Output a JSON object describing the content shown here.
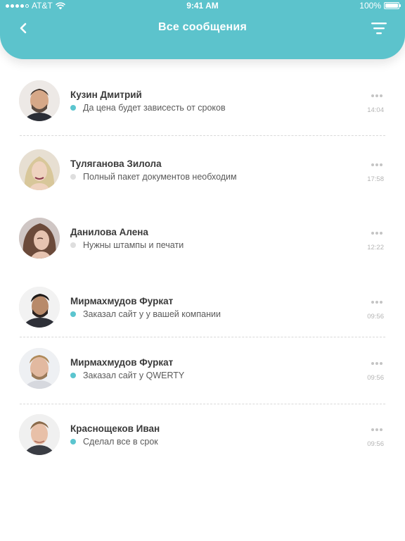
{
  "status_bar": {
    "carrier": "AT&T",
    "time": "9:41 AM",
    "battery": "100%",
    "battery_level": 1.0
  },
  "header": {
    "title": "Все сообщения",
    "back_icon": "chevron-left-icon",
    "filter_icon": "filter-icon"
  },
  "colors": {
    "accent": "#5cc3cc",
    "unread_dot": "#5bc5cf",
    "read_dot": "#dedede",
    "time_text": "#b4b4b4"
  },
  "messages": [
    {
      "name": "Кузин Дмитрий",
      "text": "Да цена будет зависесть от сроков",
      "time": "14:04",
      "unread": true
    },
    {
      "name": "Туляганова Зилола",
      "text": "Полный пакет документов необходим",
      "time": "17:58",
      "unread": false
    },
    {
      "name": "Данилова Алена",
      "text": "Нужны штампы и печати",
      "time": "12:22",
      "unread": false
    },
    {
      "name": "Мирмахмудов Фуркат",
      "text": "Заказал сайт у у вашей компании",
      "time": "09:56",
      "unread": true
    },
    {
      "name": "Мирмахмудов Фуркат",
      "text": "Заказал сайт у QWERTY",
      "time": "09:56",
      "unread": true
    },
    {
      "name": "Краснощеков Иван",
      "text": "Сделал все в срок",
      "time": "09:56",
      "unread": true
    }
  ]
}
